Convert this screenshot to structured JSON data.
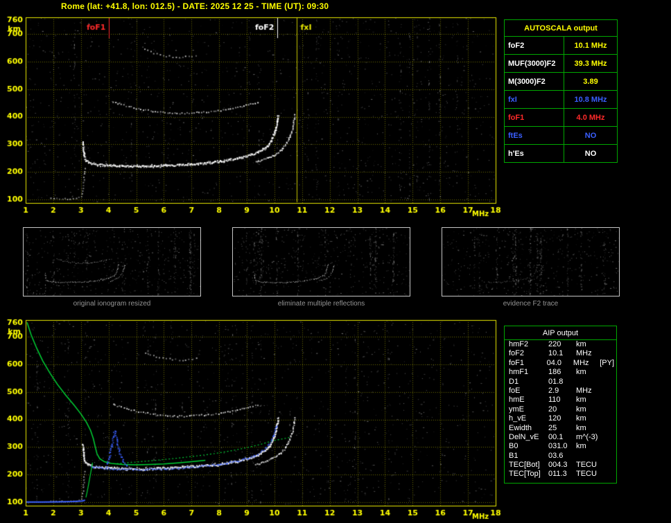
{
  "header": {
    "title": "Rome (lat: +41.8, lon: 012.5) - DATE: 2025 12 25 - TIME (UT): 09:30"
  },
  "colors": {
    "yellow": "#ffff00",
    "frame": "#e8e800",
    "grid": "#6e6e00",
    "green_border": "#00a800",
    "trace_green": "#00d234",
    "blue": "#3a5fff",
    "red": "#ff2a2a",
    "white": "#ffffff",
    "caption_gray": "#959595"
  },
  "autoscala": {
    "title": "AUTOSCALA output",
    "rows": [
      {
        "label": "foF2",
        "value": "10.1 MHz",
        "label_color": "#ffffff",
        "value_color": "#ffff00"
      },
      {
        "label": "MUF(3000)F2",
        "value": "39.3 MHz",
        "label_color": "#ffffff",
        "value_color": "#ffff00"
      },
      {
        "label": "M(3000)F2",
        "value": "3.89",
        "label_color": "#ffffff",
        "value_color": "#ffff00"
      },
      {
        "label": "fxI",
        "value": "10.8 MHz",
        "label_color": "#3a5fff",
        "value_color": "#3a5fff"
      },
      {
        "label": "foF1",
        "value": "4.0 MHz",
        "label_color": "#ff2a2a",
        "value_color": "#ff2a2a"
      },
      {
        "label": "ftEs",
        "value": "NO",
        "label_color": "#3a5fff",
        "value_color": "#3a5fff"
      },
      {
        "label": "h'Es",
        "value": "NO",
        "label_color": "#ffffff",
        "value_color": "#ffffff"
      }
    ]
  },
  "thumbnails": [
    {
      "caption": "original ionogram resized"
    },
    {
      "caption": "eliminate multiple reflections"
    },
    {
      "caption": "evidence F2 trace"
    }
  ],
  "aip": {
    "title": "AIP output",
    "rows": [
      {
        "label": "hmF2",
        "value": "220",
        "unit": "km"
      },
      {
        "label": "foF2",
        "value": "10.1",
        "unit": "MHz"
      },
      {
        "label": "foF1",
        "value": "04.0",
        "unit": "MHz",
        "extra": "[PY]"
      },
      {
        "label": "hmF1",
        "value": "186",
        "unit": "km"
      },
      {
        "label": "D1",
        "value": "01.8",
        "unit": ""
      },
      {
        "label": "foE",
        "value": "2.9",
        "unit": "MHz"
      },
      {
        "label": "hmE",
        "value": "110",
        "unit": "km"
      },
      {
        "label": "ymE",
        "value": "20",
        "unit": "km"
      },
      {
        "label": "h_vE",
        "value": "120",
        "unit": "km"
      },
      {
        "label": "Ewidth",
        "value": "25",
        "unit": "km"
      },
      {
        "label": "DelN_vE",
        "value": "00.1",
        "unit": "m^(-3)"
      },
      {
        "label": "B0",
        "value": "031.0",
        "unit": "km"
      },
      {
        "label": "B1",
        "value": "03.6",
        "unit": ""
      },
      {
        "label": "TEC[Bot]",
        "value": "004.3",
        "unit": "TECU"
      },
      {
        "label": "TEC[Top]",
        "value": "011.3",
        "unit": "TECU"
      }
    ]
  },
  "chart_data": {
    "type": "scatter",
    "title": "Vertical incidence ionogram: virtual height (km) vs sounding frequency (MHz), Rome 2025-12-25 09:30 UT",
    "x_axis": {
      "label": "MHz",
      "min": 1,
      "max": 18,
      "ticks": [
        1,
        2,
        3,
        4,
        5,
        6,
        7,
        8,
        9,
        10,
        11,
        12,
        13,
        14,
        15,
        16,
        17,
        18
      ]
    },
    "y_axis": {
      "label": "km",
      "min": 88,
      "max": 760,
      "top_label": "760",
      "ticks": [
        700,
        600,
        500,
        400,
        300,
        200,
        100
      ]
    },
    "markers": [
      {
        "name": "foF1",
        "mhz": 4.0,
        "color": "#ff2a2a",
        "side": "left",
        "full_height": false
      },
      {
        "name": "foF2",
        "mhz": 10.1,
        "color": "#ffffff",
        "side": "left",
        "full_height": false
      },
      {
        "name": "fxI",
        "mhz": 10.8,
        "color": "#e8e800",
        "side": "right",
        "full_height": true
      }
    ],
    "traces": {
      "f_main": [
        [
          3.05,
          310
        ],
        [
          3.08,
          285
        ],
        [
          3.1,
          262
        ],
        [
          3.15,
          246
        ],
        [
          3.25,
          237
        ],
        [
          3.45,
          231
        ],
        [
          3.7,
          228
        ],
        [
          4,
          226
        ],
        [
          4.4,
          224
        ],
        [
          4.9,
          223
        ],
        [
          5.4,
          223
        ],
        [
          5.9,
          225
        ],
        [
          6.4,
          227
        ],
        [
          6.9,
          230
        ],
        [
          7.4,
          234
        ],
        [
          7.9,
          239
        ],
        [
          8.3,
          245
        ],
        [
          8.7,
          252
        ],
        [
          9,
          260
        ],
        [
          9.3,
          270
        ],
        [
          9.55,
          282
        ],
        [
          9.72,
          295
        ],
        [
          9.84,
          310
        ],
        [
          9.93,
          328
        ],
        [
          10,
          348
        ],
        [
          10.05,
          370
        ],
        [
          10.09,
          392
        ],
        [
          10.12,
          412
        ]
      ],
      "f_extraordinary": [
        [
          9.3,
          238
        ],
        [
          9.6,
          247
        ],
        [
          9.85,
          257
        ],
        [
          10.05,
          268
        ],
        [
          10.2,
          280
        ],
        [
          10.33,
          294
        ],
        [
          10.44,
          310
        ],
        [
          10.53,
          328
        ],
        [
          10.6,
          348
        ],
        [
          10.66,
          370
        ],
        [
          10.7,
          392
        ],
        [
          10.73,
          412
        ]
      ],
      "second_reflection": [
        [
          4.15,
          456
        ],
        [
          4.45,
          446
        ],
        [
          4.8,
          437
        ],
        [
          5.15,
          429
        ],
        [
          5.5,
          423
        ],
        [
          5.85,
          419
        ],
        [
          6.2,
          416
        ],
        [
          6.55,
          414
        ],
        [
          6.9,
          415
        ],
        [
          7.25,
          417
        ],
        [
          7.6,
          420
        ],
        [
          7.95,
          424
        ],
        [
          8.3,
          429
        ],
        [
          8.65,
          436
        ],
        [
          8.95,
          443
        ],
        [
          9.2,
          450
        ],
        [
          9.45,
          458
        ]
      ],
      "third_reflection": [
        [
          5.3,
          645
        ],
        [
          5.6,
          633
        ],
        [
          5.95,
          624
        ],
        [
          6.3,
          619
        ],
        [
          6.65,
          618
        ],
        [
          7,
          621
        ],
        [
          7.3,
          626
        ]
      ],
      "e_region_scatter": [
        [
          1.9,
          108
        ],
        [
          2.2,
          106
        ],
        [
          2.5,
          105
        ],
        [
          2.8,
          107
        ],
        [
          3,
          112
        ],
        [
          3.05,
          135
        ],
        [
          3.08,
          165
        ],
        [
          3.1,
          195
        ],
        [
          3.12,
          225
        ]
      ],
      "profile_topside_green": [
        [
          1.05,
          752
        ],
        [
          1.2,
          706
        ],
        [
          1.4,
          658
        ],
        [
          1.62,
          612
        ],
        [
          1.88,
          568
        ],
        [
          2.15,
          527
        ],
        [
          2.45,
          488
        ],
        [
          2.75,
          452
        ],
        [
          3,
          420
        ],
        [
          3.2,
          390
        ],
        [
          3.35,
          360
        ],
        [
          3.45,
          330
        ],
        [
          3.52,
          300
        ],
        [
          3.58,
          276
        ],
        [
          3.68,
          258
        ],
        [
          3.85,
          247
        ],
        [
          4.1,
          241
        ],
        [
          4.5,
          237
        ],
        [
          5,
          236
        ],
        [
          5.5,
          237
        ],
        [
          6,
          239
        ],
        [
          6.5,
          243
        ],
        [
          7,
          247
        ],
        [
          7.5,
          252
        ]
      ],
      "profile_valley_green": [
        [
          3.42,
          244
        ],
        [
          3.38,
          222
        ],
        [
          3.34,
          200
        ],
        [
          3.3,
          178
        ],
        [
          3.26,
          156
        ],
        [
          3.22,
          136
        ],
        [
          3.18,
          118
        ]
      ],
      "profile_dotted_green": [
        [
          4.3,
          240
        ],
        [
          5,
          246
        ],
        [
          5.7,
          252
        ],
        [
          6.4,
          259
        ],
        [
          7.1,
          267
        ],
        [
          7.8,
          276
        ],
        [
          8.4,
          286
        ],
        [
          9,
          298
        ],
        [
          9.5,
          310
        ],
        [
          9.9,
          322
        ],
        [
          10.3,
          330
        ],
        [
          10.6,
          336
        ]
      ],
      "fitted_blue": [
        [
          3.35,
          230
        ],
        [
          3.7,
          226
        ],
        [
          4.1,
          223
        ],
        [
          4.6,
          221
        ],
        [
          5.1,
          221
        ],
        [
          5.6,
          222
        ],
        [
          6.1,
          224
        ],
        [
          6.6,
          227
        ],
        [
          7.1,
          231
        ],
        [
          7.6,
          235
        ],
        [
          8,
          240
        ],
        [
          8.4,
          247
        ],
        [
          8.8,
          255
        ],
        [
          9.1,
          264
        ],
        [
          9.35,
          275
        ],
        [
          9.55,
          288
        ],
        [
          9.7,
          302
        ],
        [
          9.82,
          318
        ],
        [
          9.92,
          338
        ],
        [
          10,
          360
        ],
        [
          10.06,
          385
        ]
      ],
      "f1_cusp_blue": [
        [
          3.9,
          234
        ],
        [
          3.96,
          252
        ],
        [
          4.02,
          274
        ],
        [
          4.08,
          300
        ],
        [
          4.13,
          326
        ],
        [
          4.17,
          350
        ],
        [
          4.2,
          360
        ],
        [
          4.24,
          344
        ],
        [
          4.3,
          318
        ],
        [
          4.37,
          290
        ],
        [
          4.45,
          264
        ],
        [
          4.55,
          244
        ],
        [
          4.7,
          234
        ]
      ],
      "e_blue_baseline": [
        [
          1,
          101
        ],
        [
          1.6,
          101
        ],
        [
          2.2,
          102
        ],
        [
          2.7,
          103
        ],
        [
          3.05,
          105
        ],
        [
          3.15,
          108
        ]
      ]
    }
  }
}
